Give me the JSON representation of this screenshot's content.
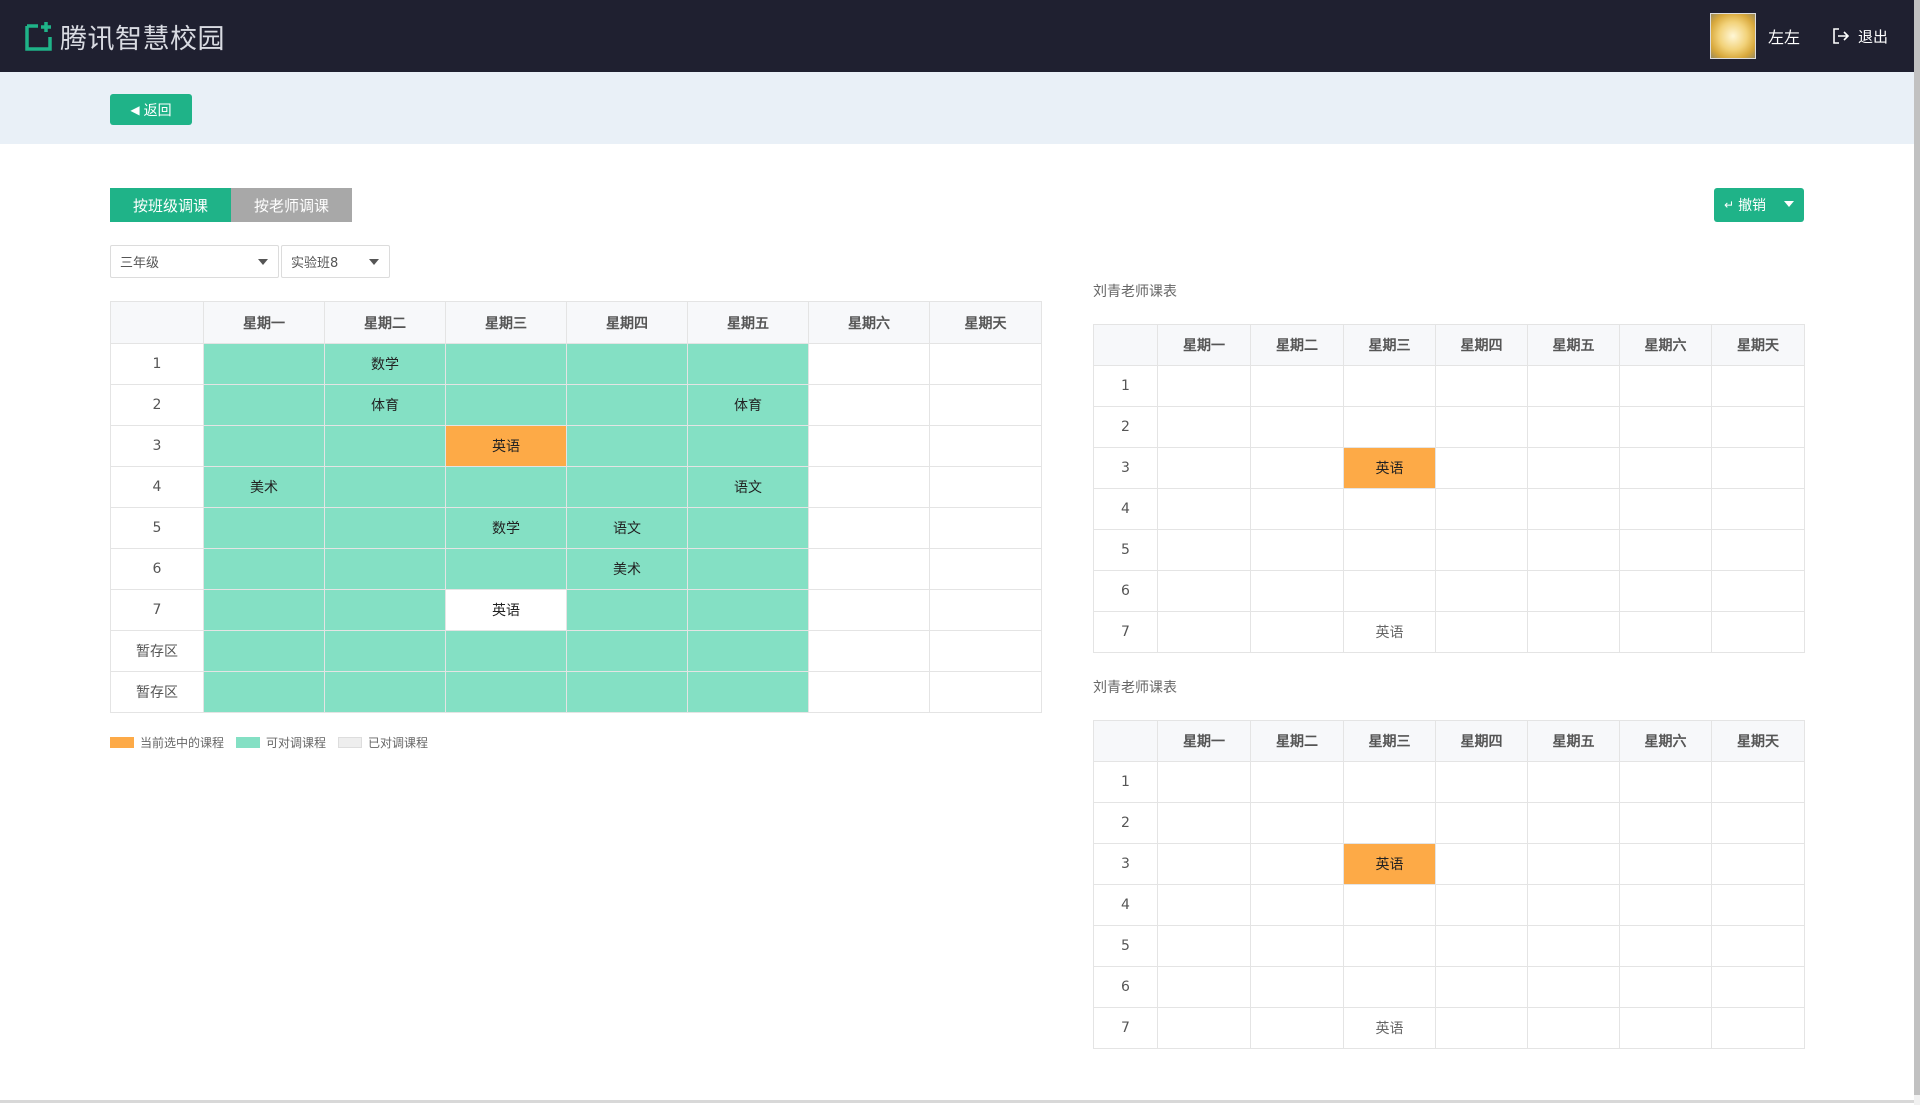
{
  "header": {
    "logo_text": "腾讯智慧校园",
    "logo_icon": "tencent-campus-logo-icon",
    "username": "左左",
    "logout_label": "退出",
    "colors": {
      "bar": "#1f2030",
      "accent": "#1fb388"
    }
  },
  "toolbar": {
    "back_label": "返回"
  },
  "tabs": [
    {
      "label": "按班级调课",
      "active": true
    },
    {
      "label": "按老师调课",
      "active": false
    }
  ],
  "undo_label": "撤销",
  "filters": {
    "grade": "三年级",
    "class": "实验班8"
  },
  "main_schedule": {
    "days": [
      "星期一",
      "星期二",
      "星期三",
      "星期四",
      "星期五",
      "星期六",
      "星期天"
    ],
    "rows": [
      {
        "label": "1",
        "cells": [
          {
            "t": "",
            "s": "avail"
          },
          {
            "t": "数学",
            "s": "avail"
          },
          {
            "t": "",
            "s": "avail"
          },
          {
            "t": "",
            "s": "avail"
          },
          {
            "t": "",
            "s": "avail"
          },
          {
            "t": "",
            "s": "plain"
          },
          {
            "t": "",
            "s": "plain"
          }
        ]
      },
      {
        "label": "2",
        "cells": [
          {
            "t": "",
            "s": "avail"
          },
          {
            "t": "体育",
            "s": "avail"
          },
          {
            "t": "",
            "s": "avail"
          },
          {
            "t": "",
            "s": "avail"
          },
          {
            "t": "体育",
            "s": "avail"
          },
          {
            "t": "",
            "s": "plain"
          },
          {
            "t": "",
            "s": "plain"
          }
        ]
      },
      {
        "label": "3",
        "cells": [
          {
            "t": "",
            "s": "avail"
          },
          {
            "t": "",
            "s": "avail"
          },
          {
            "t": "英语",
            "s": "selected"
          },
          {
            "t": "",
            "s": "avail"
          },
          {
            "t": "",
            "s": "avail"
          },
          {
            "t": "",
            "s": "plain"
          },
          {
            "t": "",
            "s": "plain"
          }
        ]
      },
      {
        "label": "4",
        "cells": [
          {
            "t": "美术",
            "s": "avail"
          },
          {
            "t": "",
            "s": "avail"
          },
          {
            "t": "",
            "s": "avail"
          },
          {
            "t": "",
            "s": "avail"
          },
          {
            "t": "语文",
            "s": "avail"
          },
          {
            "t": "",
            "s": "plain"
          },
          {
            "t": "",
            "s": "plain"
          }
        ]
      },
      {
        "label": "5",
        "cells": [
          {
            "t": "",
            "s": "avail"
          },
          {
            "t": "",
            "s": "avail"
          },
          {
            "t": "数学",
            "s": "avail"
          },
          {
            "t": "语文",
            "s": "avail"
          },
          {
            "t": "",
            "s": "avail"
          },
          {
            "t": "",
            "s": "plain"
          },
          {
            "t": "",
            "s": "plain"
          }
        ]
      },
      {
        "label": "6",
        "cells": [
          {
            "t": "",
            "s": "avail"
          },
          {
            "t": "",
            "s": "avail"
          },
          {
            "t": "",
            "s": "avail"
          },
          {
            "t": "美术",
            "s": "avail"
          },
          {
            "t": "",
            "s": "avail"
          },
          {
            "t": "",
            "s": "plain"
          },
          {
            "t": "",
            "s": "plain"
          }
        ]
      },
      {
        "label": "7",
        "cells": [
          {
            "t": "",
            "s": "avail"
          },
          {
            "t": "",
            "s": "avail"
          },
          {
            "t": "英语",
            "s": "done"
          },
          {
            "t": "",
            "s": "avail"
          },
          {
            "t": "",
            "s": "avail"
          },
          {
            "t": "",
            "s": "plain"
          },
          {
            "t": "",
            "s": "plain"
          }
        ]
      },
      {
        "label": "暂存区",
        "cells": [
          {
            "t": "",
            "s": "avail"
          },
          {
            "t": "",
            "s": "avail"
          },
          {
            "t": "",
            "s": "avail"
          },
          {
            "t": "",
            "s": "avail"
          },
          {
            "t": "",
            "s": "avail"
          },
          {
            "t": "",
            "s": "plain"
          },
          {
            "t": "",
            "s": "plain"
          }
        ]
      },
      {
        "label": "暂存区",
        "cells": [
          {
            "t": "",
            "s": "avail"
          },
          {
            "t": "",
            "s": "avail"
          },
          {
            "t": "",
            "s": "avail"
          },
          {
            "t": "",
            "s": "avail"
          },
          {
            "t": "",
            "s": "avail"
          },
          {
            "t": "",
            "s": "plain"
          },
          {
            "t": "",
            "s": "plain"
          }
        ]
      }
    ]
  },
  "legend": [
    {
      "label": "当前选中的课程",
      "color": "#fdaa47"
    },
    {
      "label": "可对调课程",
      "color": "#84e0c4"
    },
    {
      "label": "已对调课程",
      "color": "#eeeeee"
    }
  ],
  "teacher_tables": [
    {
      "title": "刘青老师课表",
      "rows": [
        {
          "label": "1",
          "cells": [
            "",
            "",
            "",
            "",
            "",
            "",
            ""
          ]
        },
        {
          "label": "2",
          "cells": [
            "",
            "",
            "",
            "",
            "",
            "",
            ""
          ]
        },
        {
          "label": "3",
          "cells": [
            "",
            "",
            "英语",
            "",
            "",
            "",
            ""
          ],
          "selected_col": 2
        },
        {
          "label": "4",
          "cells": [
            "",
            "",
            "",
            "",
            "",
            "",
            ""
          ]
        },
        {
          "label": "5",
          "cells": [
            "",
            "",
            "",
            "",
            "",
            "",
            ""
          ]
        },
        {
          "label": "6",
          "cells": [
            "",
            "",
            "",
            "",
            "",
            "",
            ""
          ]
        },
        {
          "label": "7",
          "cells": [
            "",
            "",
            "英语",
            "",
            "",
            "",
            ""
          ]
        }
      ]
    },
    {
      "title": "刘青老师课表",
      "rows": [
        {
          "label": "1",
          "cells": [
            "",
            "",
            "",
            "",
            "",
            "",
            ""
          ]
        },
        {
          "label": "2",
          "cells": [
            "",
            "",
            "",
            "",
            "",
            "",
            ""
          ]
        },
        {
          "label": "3",
          "cells": [
            "",
            "",
            "英语",
            "",
            "",
            "",
            ""
          ],
          "selected_col": 2
        },
        {
          "label": "4",
          "cells": [
            "",
            "",
            "",
            "",
            "",
            "",
            ""
          ]
        },
        {
          "label": "5",
          "cells": [
            "",
            "",
            "",
            "",
            "",
            "",
            ""
          ]
        },
        {
          "label": "6",
          "cells": [
            "",
            "",
            "",
            "",
            "",
            "",
            ""
          ]
        },
        {
          "label": "7",
          "cells": [
            "",
            "",
            "英语",
            "",
            "",
            "",
            ""
          ]
        }
      ]
    }
  ]
}
